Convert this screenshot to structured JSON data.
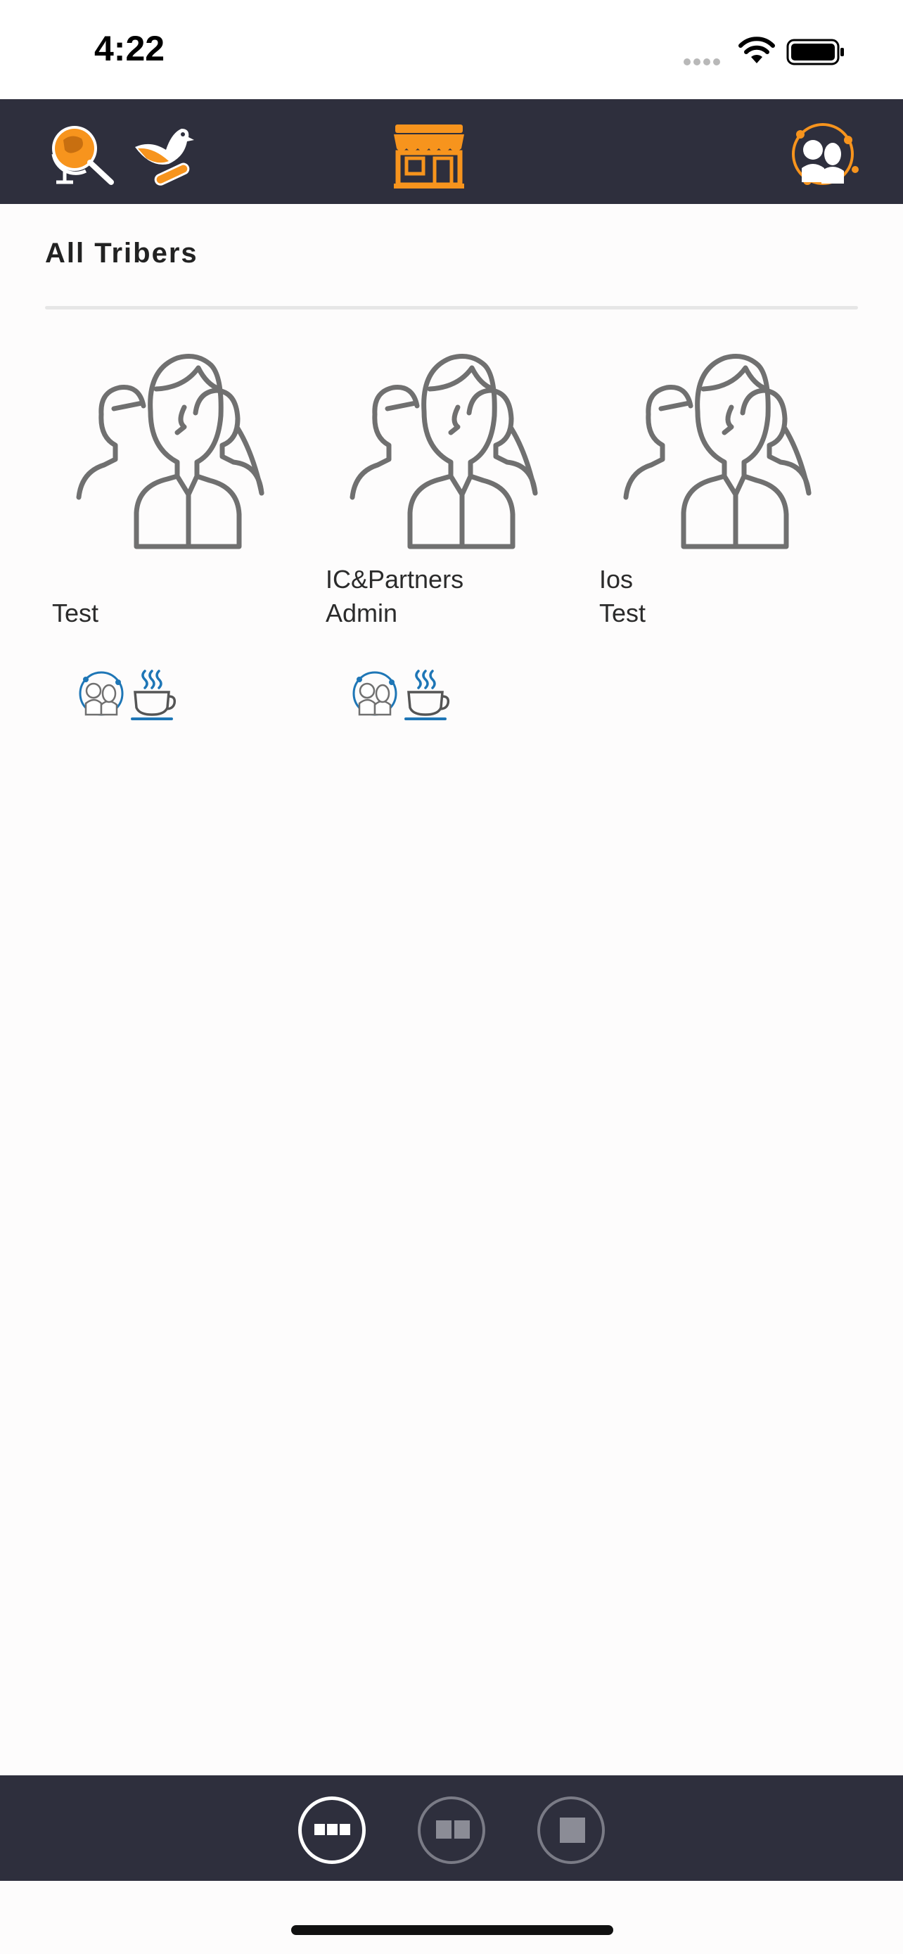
{
  "status_bar": {
    "time": "4:22"
  },
  "top_bar": {
    "icons": [
      "globe-search-icon",
      "pigeon-letter-icon",
      "storefront-icon",
      "tribe-network-icon"
    ],
    "accent_color": "#f7941d",
    "background": "#2e2f3d"
  },
  "section": {
    "title": "All Tribers"
  },
  "members": [
    {
      "first_name": "",
      "last_name": "Test",
      "actions": [
        "tribe-network-icon",
        "coffee-cup-icon"
      ]
    },
    {
      "first_name": "IC&Partners",
      "last_name": "Admin",
      "actions": [
        "tribe-network-icon",
        "coffee-cup-icon"
      ]
    },
    {
      "first_name": "Ios",
      "last_name": "Test",
      "actions": []
    }
  ],
  "bottom_bar": {
    "view_options": [
      "three-column-view-icon",
      "two-column-view-icon",
      "single-view-icon"
    ],
    "selected": "three-column-view-icon"
  },
  "colors": {
    "action_blue": "#1e76b6",
    "avatar_gray": "#707070"
  }
}
